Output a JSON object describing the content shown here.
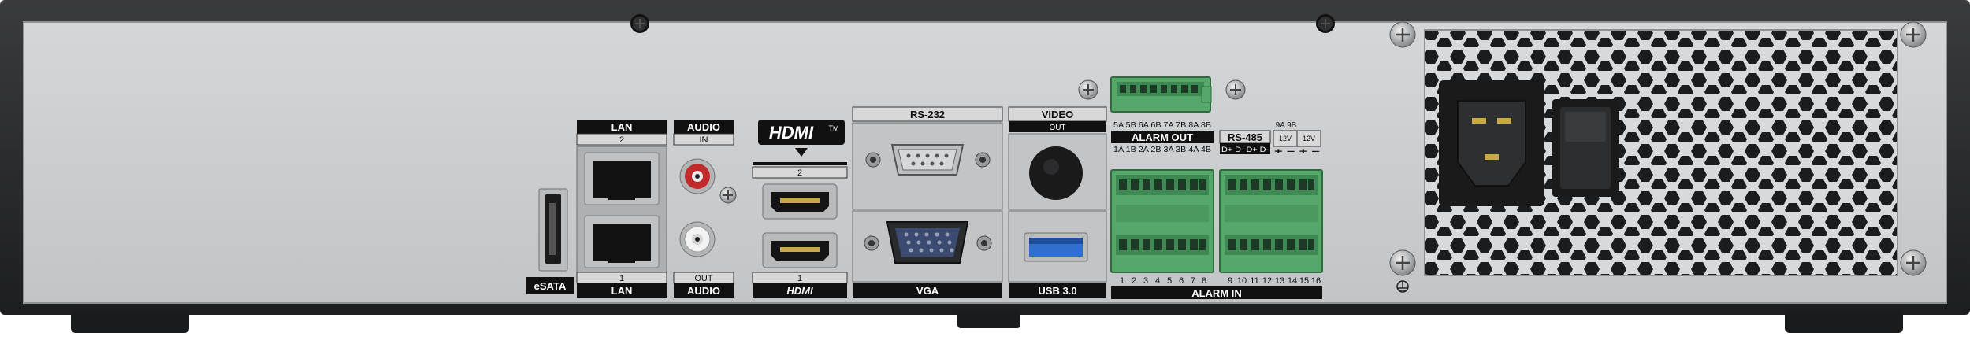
{
  "labels": {
    "esata": "eSATA",
    "lan_top": "LAN",
    "lan_port2": "2",
    "lan_port1": "1",
    "lan_bottom": "LAN",
    "audio_top": "AUDIO",
    "audio_in": "IN",
    "audio_out": "OUT",
    "audio_bottom": "AUDIO",
    "hdmi_logo": "HDMI",
    "hdmi_tm": "TM",
    "hdmi_port2": "2",
    "hdmi_port1": "1",
    "hdmi_bottom": "HDMI",
    "rs232": "RS-232",
    "vga": "VGA",
    "video_out_top": "VIDEO",
    "video_out_sub": "OUT",
    "usb": "USB 3.0",
    "alarm_out_pins_top": "5A 5B 6A 6B 7A 7B 8A 8B",
    "alarm_out": "ALARM OUT",
    "alarm_out_pins_bottom": "1A 1B 2A 2B 3A 3B 4A 4B",
    "rs485": "RS-485",
    "rs485_pins": "D+ D- D+ D-",
    "relay_pins": "9A 9B",
    "power_12v_a": "12V",
    "power_12v_b": "12V",
    "power_signs": "+ − + −",
    "alarm_in": "ALARM IN",
    "alarm_in_left": [
      "1",
      "2",
      "3",
      "4",
      "5",
      "6",
      "7",
      "8"
    ],
    "alarm_in_right": [
      "9",
      "10",
      "11",
      "12",
      "13",
      "14",
      "15",
      "16"
    ]
  },
  "colors": {
    "chassis": "#2b2c2e",
    "panel": "#c9cbcd",
    "terminal_green": "#56a86a",
    "label_black": "#111111",
    "usb_blue": "#2f6fd0",
    "audio_red": "#c02a2a"
  }
}
